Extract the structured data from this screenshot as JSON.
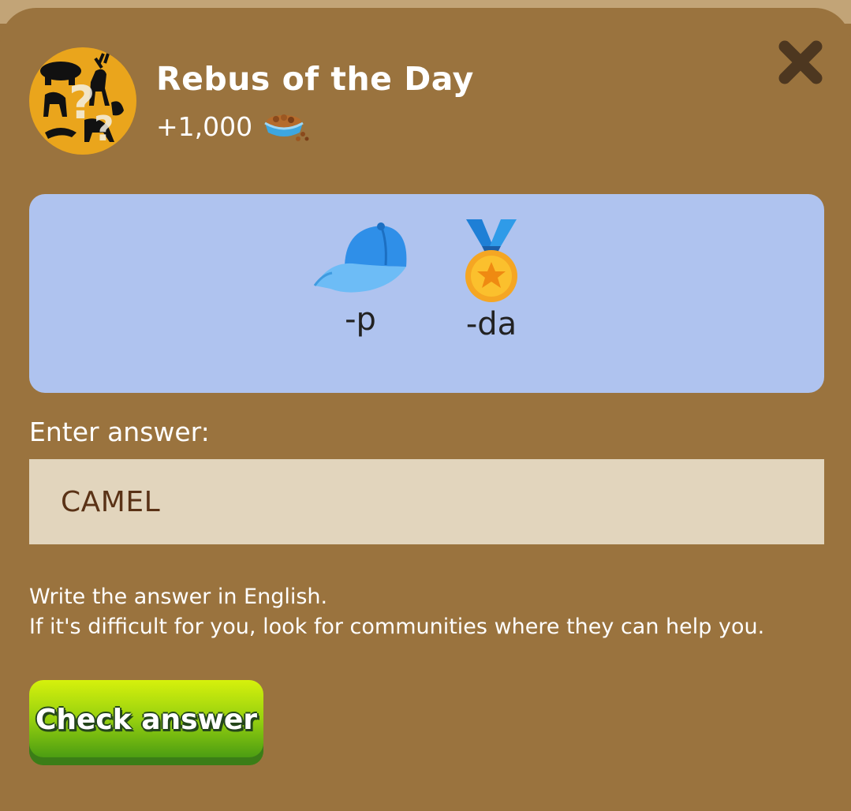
{
  "header": {
    "title": "Rebus of the Day",
    "reward_amount": "+1,000",
    "reward_icon": "pet-food-bowl-icon",
    "avatar_icon": "animals-question-marks-icon",
    "close_icon": "close-icon"
  },
  "puzzle": {
    "clues": [
      {
        "icon": "cap-icon",
        "text": "-p"
      },
      {
        "icon": "medal-icon",
        "text": "-da"
      }
    ]
  },
  "answer": {
    "label": "Enter answer:",
    "value": "CAMEL"
  },
  "hint": {
    "line1": "Write the answer in English.",
    "line2": "If it's difficult for you, look for communities where they can help you."
  },
  "actions": {
    "check_label": "Check answer"
  },
  "colors": {
    "background": "#9a733e",
    "card": "#afc3ef",
    "input": "#e2d5bd",
    "button": "#7cc212",
    "avatar": "#eaa51c"
  }
}
